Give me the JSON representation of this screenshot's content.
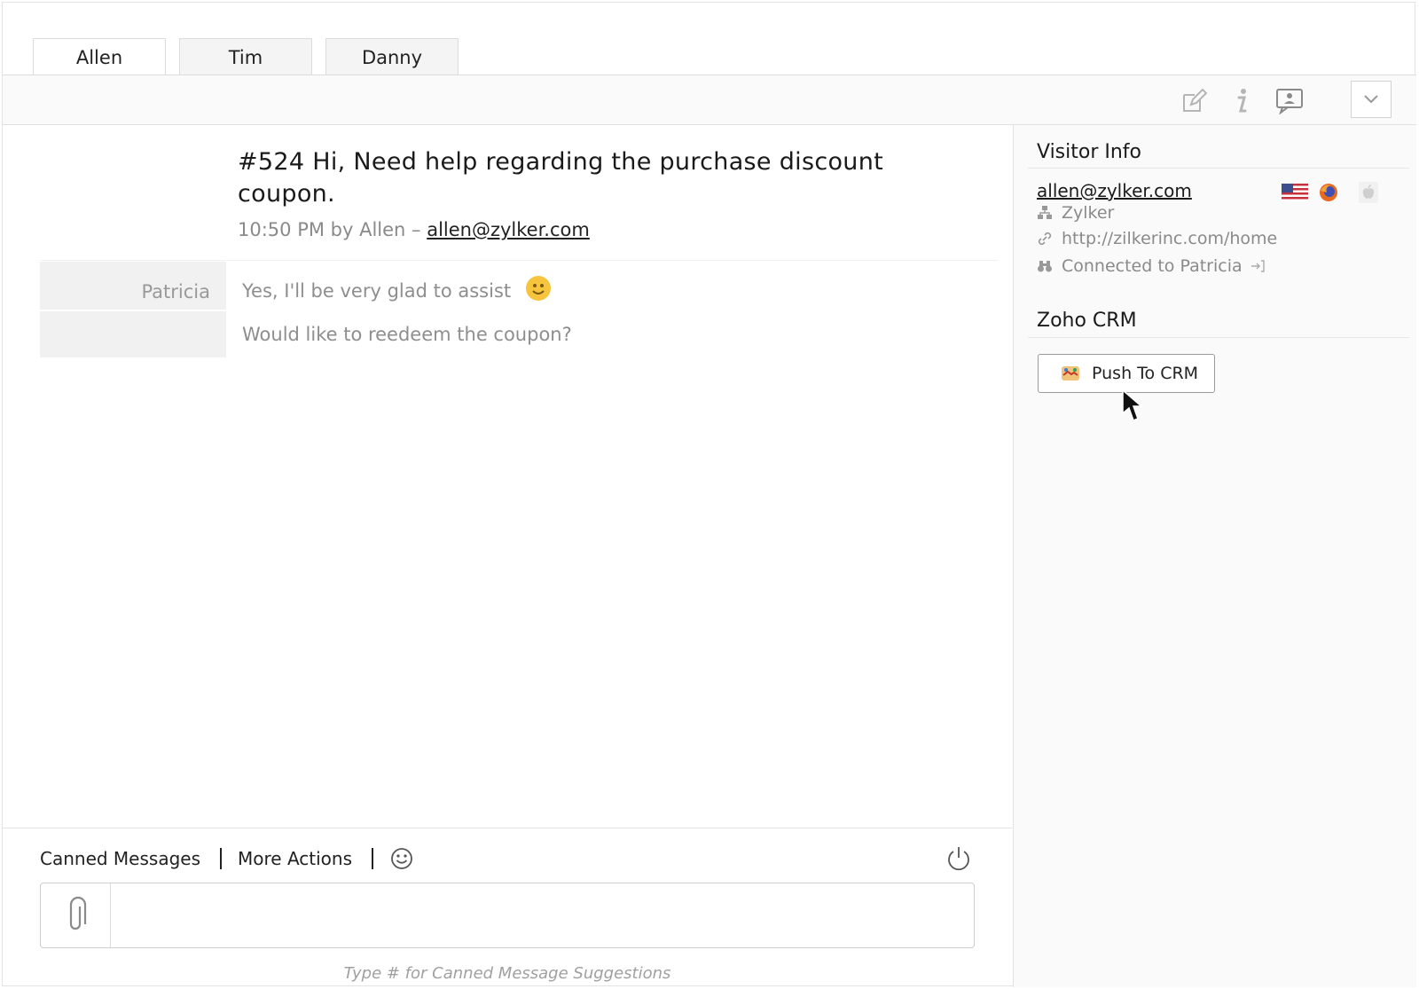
{
  "tabs": [
    {
      "label": "Allen",
      "active": true
    },
    {
      "label": "Tim",
      "active": false
    },
    {
      "label": "Danny",
      "active": false
    }
  ],
  "toolbar": {
    "icons": [
      "edit-icon",
      "info-icon",
      "chat-bubble-icon",
      "chevron-down-icon"
    ]
  },
  "chat": {
    "question": "#524 Hi, Need help regarding the purchase discount coupon.",
    "meta_prefix": "10:50 PM by Allen – ",
    "meta_email": "allen@zylker.com",
    "sender": "Patricia",
    "messages": [
      "Yes, I'll be very glad to assist",
      "Would like to reedeem the coupon?"
    ]
  },
  "composer": {
    "canned_label": "Canned Messages",
    "more_actions_label": "More Actions",
    "input_placeholder": "",
    "hint": "Type # for Canned Message Suggestions"
  },
  "sidebar": {
    "visitor_info_title": "Visitor Info",
    "email": "allen@zylker.com",
    "company": "Zylker",
    "url": "http://zilkerinc.com/home",
    "connection": "Connected to Patricia",
    "crm_title": "Zoho CRM",
    "crm_button": "Push To CRM"
  },
  "colors": {
    "smiley": "#f7c43d",
    "border": "#dcdcdc",
    "muted_text": "#8a8a8a"
  }
}
